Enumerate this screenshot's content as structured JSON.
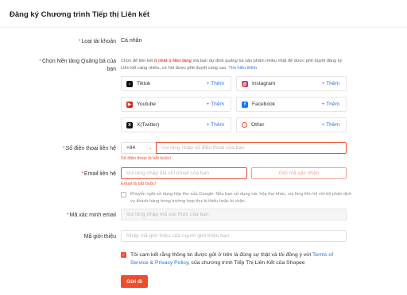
{
  "page": {
    "title": "Đăng ký Chương trình Tiếp thị Liên kết"
  },
  "account_type": {
    "label": "Loại tài khoản",
    "value": "Cá nhân"
  },
  "platform": {
    "label_line1": "Chọn Nền tảng Quảng bá của",
    "label_line2": "bạn",
    "note_prefix": "Chọn để liên kết ",
    "note_highlight": "ít nhất 1 Nền tảng",
    "note_mid": " mà bạn dự định quảng bá sản phẩm nhiều nhất để được phê duyệt đăng ký Liên kết càng nhiều, cơ hội được phê duyệt càng cao. ",
    "note_link": "Tìm hiểu thêm",
    "add_label": "+ Thêm",
    "items": [
      {
        "name": "Tiktok",
        "icon": "tiktok-icon"
      },
      {
        "name": "Instagram",
        "icon": "instagram-icon"
      },
      {
        "name": "Youtube",
        "icon": "youtube-icon"
      },
      {
        "name": "Facebook",
        "icon": "facebook-icon"
      },
      {
        "name": "X(Twitter)",
        "icon": "x-twitter-icon"
      },
      {
        "name": "Other",
        "icon": "other-icon"
      }
    ]
  },
  "phone": {
    "label": "Số điện thoại liên hệ",
    "country_code": "+84",
    "placeholder": "Vui lòng nhập số điện thoại của bạn",
    "error": "Số điện thoại là bắt buộc!"
  },
  "email": {
    "label": "Email liên hệ",
    "placeholder": "Vui lòng nhập địa chỉ email của bạn",
    "otp_button": "Gửi mã xác nhận",
    "error": "Email là bắt buộc!",
    "google_note": "Khuyến nghị sử dụng hộp thư của Google. Nếu bạn sử dụng các hộp thư khác, vui lòng liên hệ với bộ phận dịch vụ khách hàng trong trường hợp thư bị thiếu hoặc bị chặn."
  },
  "verify": {
    "label": "Mã xác minh email",
    "placeholder": "Vui lòng nhập mã xác thực của bạn"
  },
  "referral": {
    "label": "Mã giới thiệu",
    "placeholder": "Nhập mã giới thiệu của người giới thiệu bạn"
  },
  "consent": {
    "text_prefix": "Tôi cam kết rằng thông tin được gửi ở trên là đúng sự thật và tôi đồng ý với ",
    "link": "Terms of Service & Privacy Policy",
    "text_suffix": ", của chương trình Tiếp Thị Liên Kết của Shopee"
  },
  "submit_label": "Gửi đi",
  "colors": {
    "accent": "#ee4d2d",
    "link": "#2673dd"
  }
}
